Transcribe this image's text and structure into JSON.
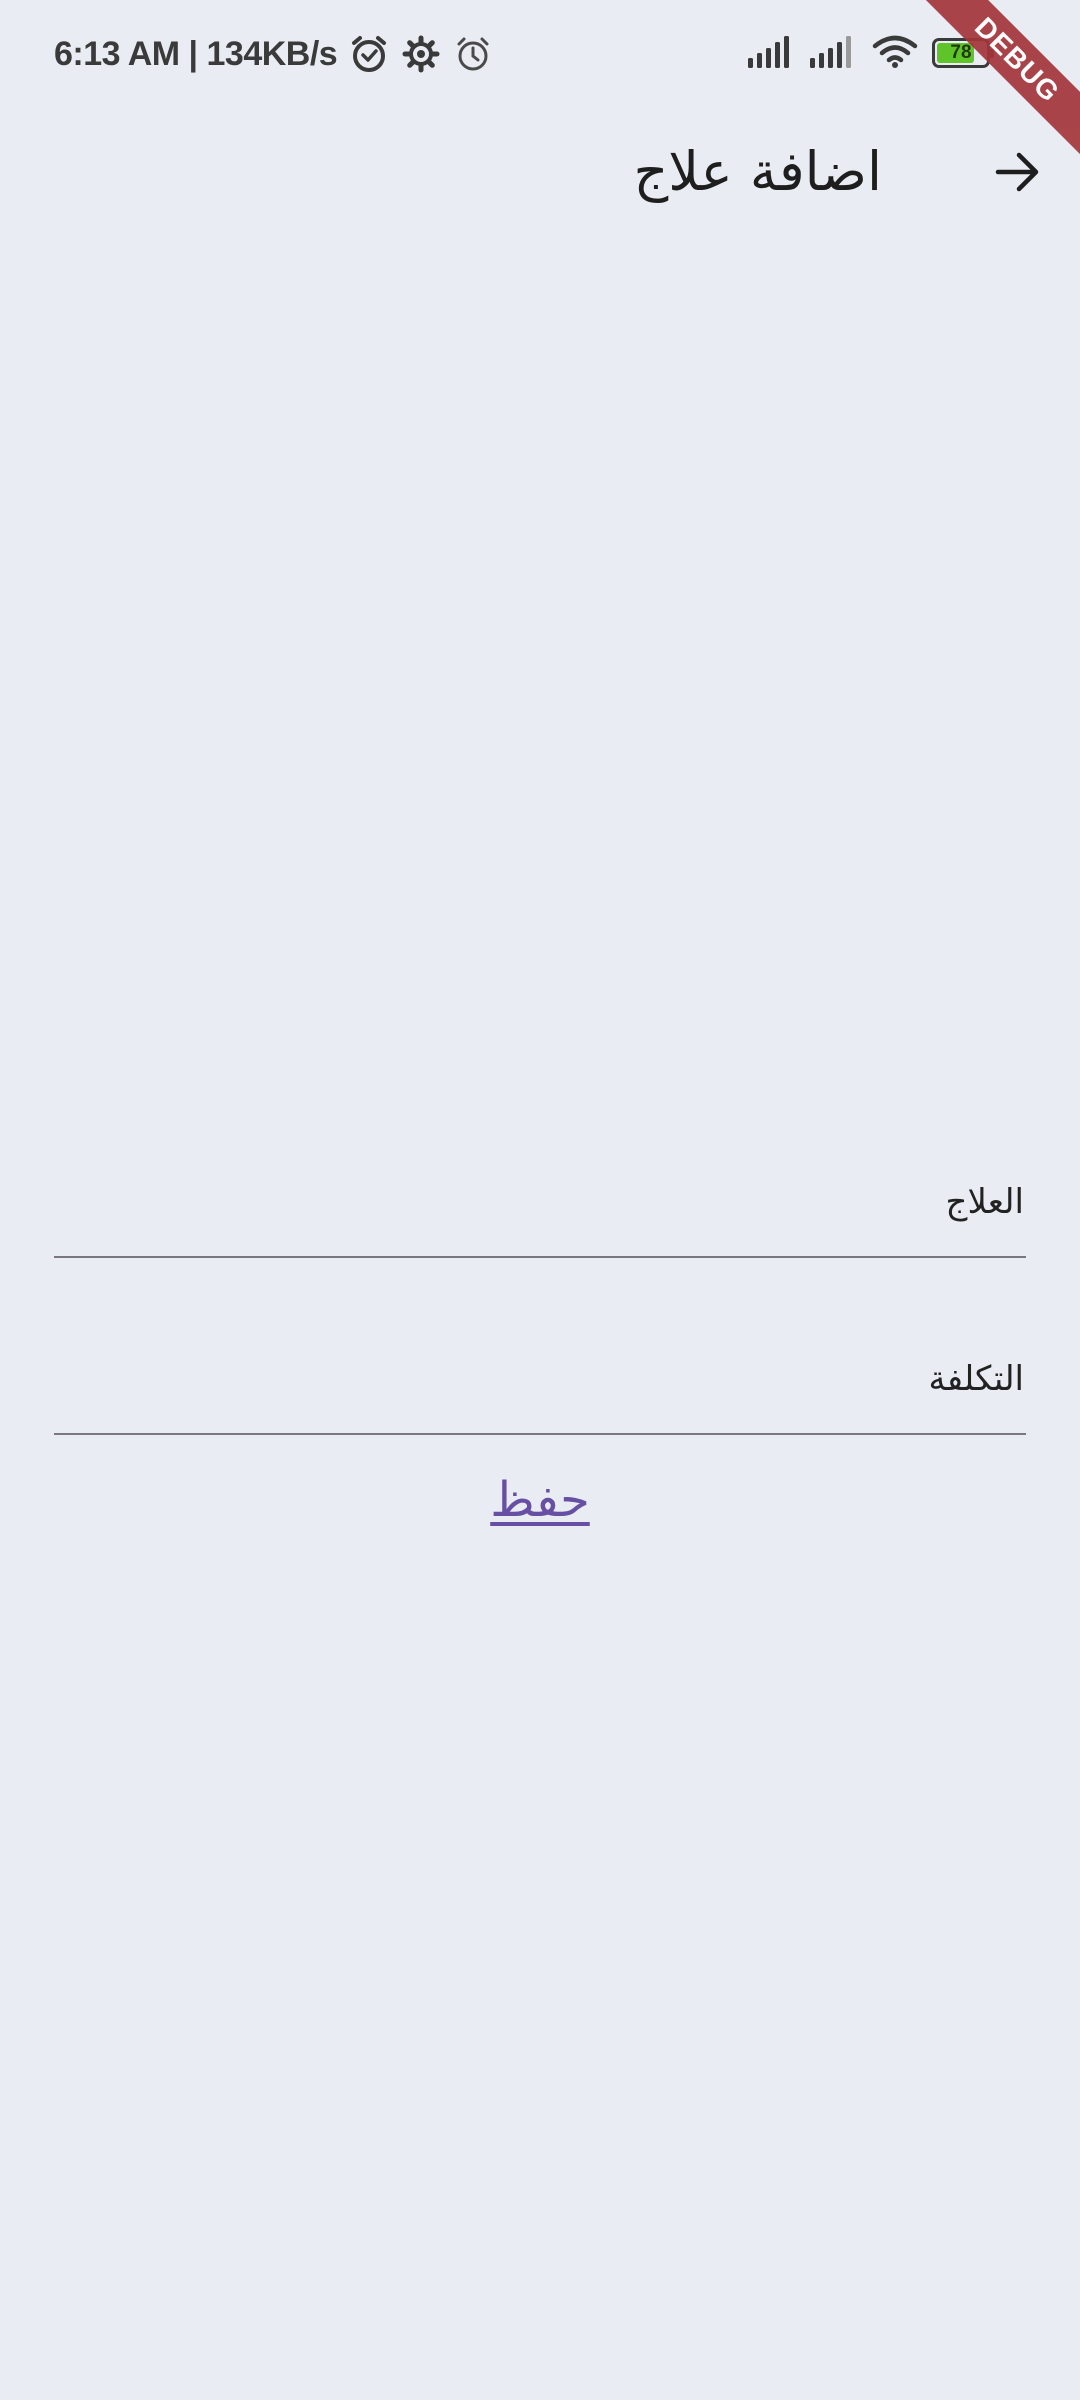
{
  "status_bar": {
    "time": "6:13 AM | 134KB/s",
    "battery": "78",
    "battery_level": 0.78,
    "icons": [
      "alarm-clock-icon",
      "settings-gear-icon",
      "alarm-icon",
      "signal-bars-icon",
      "signal-bars-icon",
      "wifi-icon",
      "battery-icon"
    ]
  },
  "debug_banner": "DEBUG",
  "app_bar": {
    "title": "اضافة علاج",
    "back_icon": "arrow-right-icon"
  },
  "form": {
    "treatment": {
      "placeholder": "العلاج",
      "value": ""
    },
    "cost": {
      "placeholder": "التكلفة",
      "value": ""
    },
    "save_label": "حفظ"
  },
  "colors": {
    "background": "#e9ecf2",
    "accent": "#6750a4",
    "debug_ribbon": "#a3353b",
    "battery_fill": "#5fc42a"
  }
}
